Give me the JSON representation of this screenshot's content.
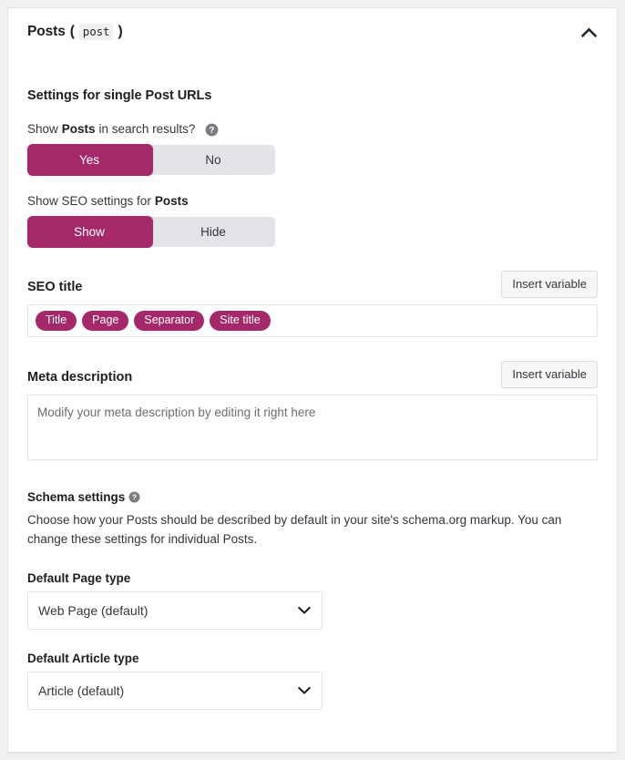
{
  "header": {
    "title": "Posts",
    "open_paren": "(",
    "code": "post",
    "close_paren": ")",
    "collapse_icon": "chevron-up-icon"
  },
  "section": {
    "title": "Settings for single Post URLs"
  },
  "search_results": {
    "label_prefix": "Show ",
    "label_bold": "Posts",
    "label_suffix": " in search results?",
    "help_icon": "question-mark-circle-icon",
    "options": [
      "Yes",
      "No"
    ],
    "selected": "Yes"
  },
  "seo_settings_toggle": {
    "label_prefix": "Show SEO settings for ",
    "label_bold": "Posts",
    "options": [
      "Show",
      "Hide"
    ],
    "selected": "Show"
  },
  "seo_title": {
    "label": "SEO title",
    "insert_variable_label": "Insert variable",
    "tags": [
      "Title",
      "Page",
      "Separator",
      "Site title"
    ]
  },
  "meta_description": {
    "label": "Meta description",
    "insert_variable_label": "Insert variable",
    "value": "",
    "placeholder": "Modify your meta description by editing it right here"
  },
  "schema": {
    "title": "Schema settings",
    "help_icon": "question-mark-circle-icon",
    "description": "Choose how your Posts should be described by default in your site's schema.org markup. You can change these settings for individual Posts.",
    "page_type": {
      "label": "Default Page type",
      "selected": "Web Page (default)",
      "chevron_icon": "chevron-down-icon"
    },
    "article_type": {
      "label": "Default Article type",
      "selected": "Article (default)",
      "chevron_icon": "chevron-down-icon"
    }
  },
  "colors": {
    "accent": "#a4286a",
    "toggle_track": "#e2e4e7",
    "page_bg": "#f1f1f1",
    "card_bg": "#ffffff",
    "text": "#32373c",
    "heading": "#1e1e1e",
    "border": "#e2e4e7"
  }
}
